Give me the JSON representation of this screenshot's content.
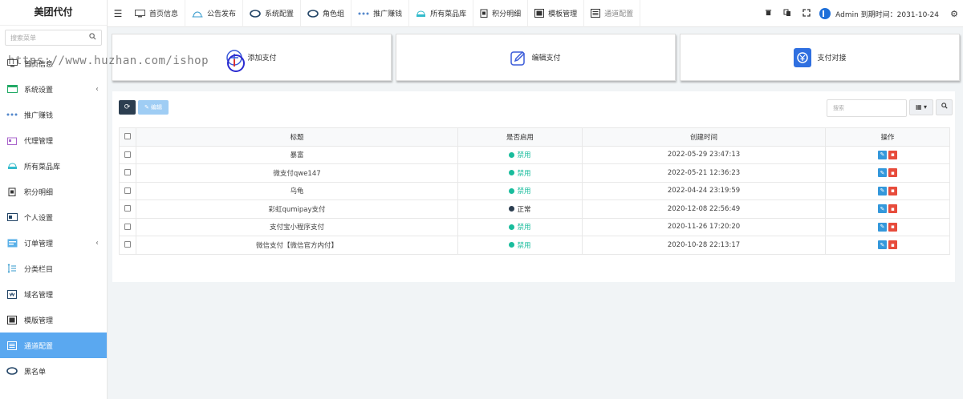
{
  "brand": "美团代付",
  "sidebar": {
    "search_placeholder": "搜索菜单",
    "items": [
      {
        "label": "首页信息",
        "icon": "monitor-icon",
        "chevron": ""
      },
      {
        "label": "系统设置",
        "icon": "window-icon",
        "chevron": "‹"
      },
      {
        "label": "推广赚钱",
        "icon": "share-icon",
        "chevron": ""
      },
      {
        "label": "代理管理",
        "icon": "agent-icon",
        "chevron": ""
      },
      {
        "label": "所有菜品库",
        "icon": "dish-icon",
        "chevron": ""
      },
      {
        "label": "积分明细",
        "icon": "points-icon",
        "chevron": ""
      },
      {
        "label": "个人设置",
        "icon": "profile-icon",
        "chevron": ""
      },
      {
        "label": "订单管理",
        "icon": "order-icon",
        "chevron": "‹"
      },
      {
        "label": "分类栏目",
        "icon": "category-icon",
        "chevron": ""
      },
      {
        "label": "域名管理",
        "icon": "domain-icon",
        "chevron": ""
      },
      {
        "label": "模版管理",
        "icon": "template-icon",
        "chevron": ""
      },
      {
        "label": "通道配置",
        "icon": "channel-icon",
        "chevron": ""
      },
      {
        "label": "黑名单",
        "icon": "blacklist-icon",
        "chevron": ""
      }
    ],
    "active_index": 11
  },
  "topbar": {
    "tabs": [
      {
        "label": "首页信息",
        "icon": "monitor-icon"
      },
      {
        "label": "公告发布",
        "icon": "announce-icon"
      },
      {
        "label": "系统配置",
        "icon": "config-icon"
      },
      {
        "label": "角色组",
        "icon": "role-icon"
      },
      {
        "label": "推广赚钱",
        "icon": "share-icon"
      },
      {
        "label": "所有菜品库",
        "icon": "dish-icon"
      },
      {
        "label": "积分明细",
        "icon": "points-icon"
      },
      {
        "label": "模板管理",
        "icon": "template-icon"
      },
      {
        "label": "通道配置",
        "icon": "channel-icon"
      }
    ],
    "user_text": "Admin 到期时间：2031-10-24"
  },
  "cards": [
    {
      "label": "添加支付",
      "icon": "add-icon"
    },
    {
      "label": "编辑支付",
      "icon": "pencil-icon"
    },
    {
      "label": "支付对接",
      "icon": "link-icon"
    }
  ],
  "toolbar": {
    "edit_label": "编辑",
    "search_placeholder": "搜索"
  },
  "table": {
    "headers": [
      "标题",
      "是否启用",
      "创建时间",
      "操作"
    ],
    "rows": [
      {
        "title": "暴富",
        "status": "禁用",
        "status_type": "off",
        "created": "2022-05-29 23:47:13"
      },
      {
        "title": "微支付qwe147",
        "status": "禁用",
        "status_type": "off",
        "created": "2022-05-21 12:36:23"
      },
      {
        "title": "乌龟",
        "status": "禁用",
        "status_type": "off",
        "created": "2022-04-24 23:19:59"
      },
      {
        "title": "彩虹qumipay支付",
        "status": "正常",
        "status_type": "on",
        "created": "2020-12-08 22:56:49"
      },
      {
        "title": "支付宝小程序支付",
        "status": "禁用",
        "status_type": "off",
        "created": "2020-11-26 17:20:20"
      },
      {
        "title": "微信支付【微信官方内付】",
        "status": "禁用",
        "status_type": "off",
        "created": "2020-10-28 22:13:17"
      }
    ]
  },
  "watermark": "https://www.huzhan.com/ishop",
  "colors": {
    "active": "#5aa8f0",
    "disabled_status": "#18bc9c",
    "enabled_status": "#2c3e50",
    "edit": "#3498db",
    "delete": "#e74c3c"
  }
}
